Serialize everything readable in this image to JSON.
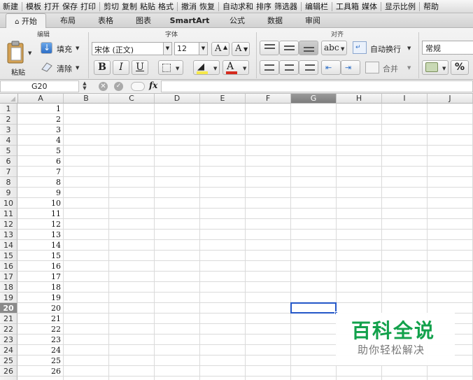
{
  "toolbar": {
    "items": [
      "新建",
      "模板",
      "打开",
      "保存",
      "打印",
      "剪切",
      "复制",
      "粘贴",
      "格式",
      "撤消",
      "恢复",
      "自动求和",
      "排序",
      "筛选器",
      "编辑栏",
      "工具箱",
      "媒体",
      "显示比例",
      "帮助"
    ]
  },
  "tabs": [
    "开始",
    "布局",
    "表格",
    "图表",
    "SmartArt",
    "公式",
    "数据",
    "审阅"
  ],
  "ribbon": {
    "groups": {
      "edit": "编辑",
      "font": "字体",
      "align": "对齐"
    },
    "paste": "粘贴",
    "fill": "填充",
    "clear": "清除",
    "font_name": "宋体 (正文)",
    "font_size": "12",
    "bold": "B",
    "italic": "I",
    "underline": "U",
    "wrap_text": "自动换行",
    "merge": "合并",
    "number_format": "常规",
    "percent": "%",
    "abc": "abc",
    "grow_font": "A",
    "shrink_font": "A",
    "font_color_letter": "A"
  },
  "formula_bar": {
    "cell_ref": "G20",
    "fx": "fx",
    "content": ""
  },
  "sheet": {
    "columns": [
      "A",
      "B",
      "C",
      "D",
      "E",
      "F",
      "G",
      "H",
      "I",
      "J"
    ],
    "selected_column": "G",
    "selected_row": "20",
    "rows": [
      "1",
      "2",
      "3",
      "4",
      "5",
      "6",
      "7",
      "8",
      "9",
      "10",
      "11",
      "12",
      "13",
      "14",
      "15",
      "16",
      "17",
      "18",
      "19",
      "20",
      "21",
      "22",
      "23",
      "24",
      "25",
      "26"
    ],
    "column_a_values": [
      "1",
      "2",
      "3",
      "4",
      "5",
      "6",
      "7",
      "8",
      "9",
      "10",
      "11",
      "12",
      "13",
      "14",
      "15",
      "16",
      "17",
      "18",
      "19",
      "20",
      "21",
      "22",
      "23",
      "24",
      "25",
      "26"
    ]
  },
  "watermark": {
    "title": "百科全说",
    "subtitle": "助你轻松解决"
  },
  "colors": {
    "selection": "#2457c8",
    "watermark_green": "#12a14b"
  }
}
